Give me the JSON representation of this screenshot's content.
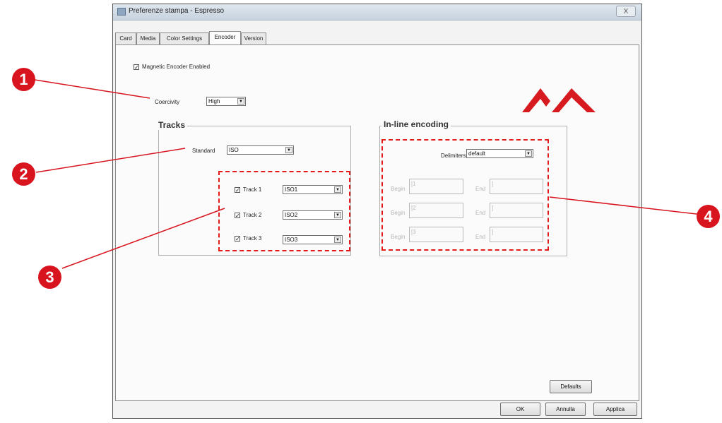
{
  "window": {
    "title": "Preferenze stampa - Espresso",
    "close_label": "X"
  },
  "tabs": [
    {
      "label": "Card",
      "active": false
    },
    {
      "label": "Media",
      "active": false
    },
    {
      "label": "Color Settings",
      "active": false
    },
    {
      "label": "Encoder",
      "active": true
    },
    {
      "label": "Version",
      "active": false
    }
  ],
  "encoder": {
    "magnetic_enabled_label": "Magnetic Encoder Enabled",
    "magnetic_enabled_checked": true,
    "coercivity_label": "Coercivity",
    "coercivity_value": "High"
  },
  "tracks": {
    "title": "Tracks",
    "standard_label": "Standard",
    "standard_value": "ISO",
    "items": [
      {
        "label": "Track 1",
        "checked": true,
        "value": "ISO1"
      },
      {
        "label": "Track 2",
        "checked": true,
        "value": "ISO2"
      },
      {
        "label": "Track 3",
        "checked": true,
        "value": "ISO3"
      }
    ]
  },
  "inline": {
    "title": "In-line encoding",
    "delimiters_label": "Delimiters",
    "delimiters_value": "default",
    "rows": [
      {
        "begin_label": "Begin",
        "begin_value": "[1",
        "end_label": "End",
        "end_value": "]"
      },
      {
        "begin_label": "Begin",
        "begin_value": "[2",
        "end_label": "End",
        "end_value": "]"
      },
      {
        "begin_label": "Begin",
        "begin_value": "[3",
        "end_label": "End",
        "end_value": "]"
      }
    ]
  },
  "buttons": {
    "defaults": "Defaults",
    "ok": "OK",
    "annulla": "Annulla",
    "applica": "Applica"
  },
  "callouts": [
    "1",
    "2",
    "3",
    "4"
  ],
  "colors": {
    "callout_red": "#d8141e",
    "dashed_red": "#e21b1b",
    "logo_red": "#d71920"
  },
  "icons": {
    "logo": "brand-logo-icon",
    "dropdown": "chevron-down-icon"
  }
}
